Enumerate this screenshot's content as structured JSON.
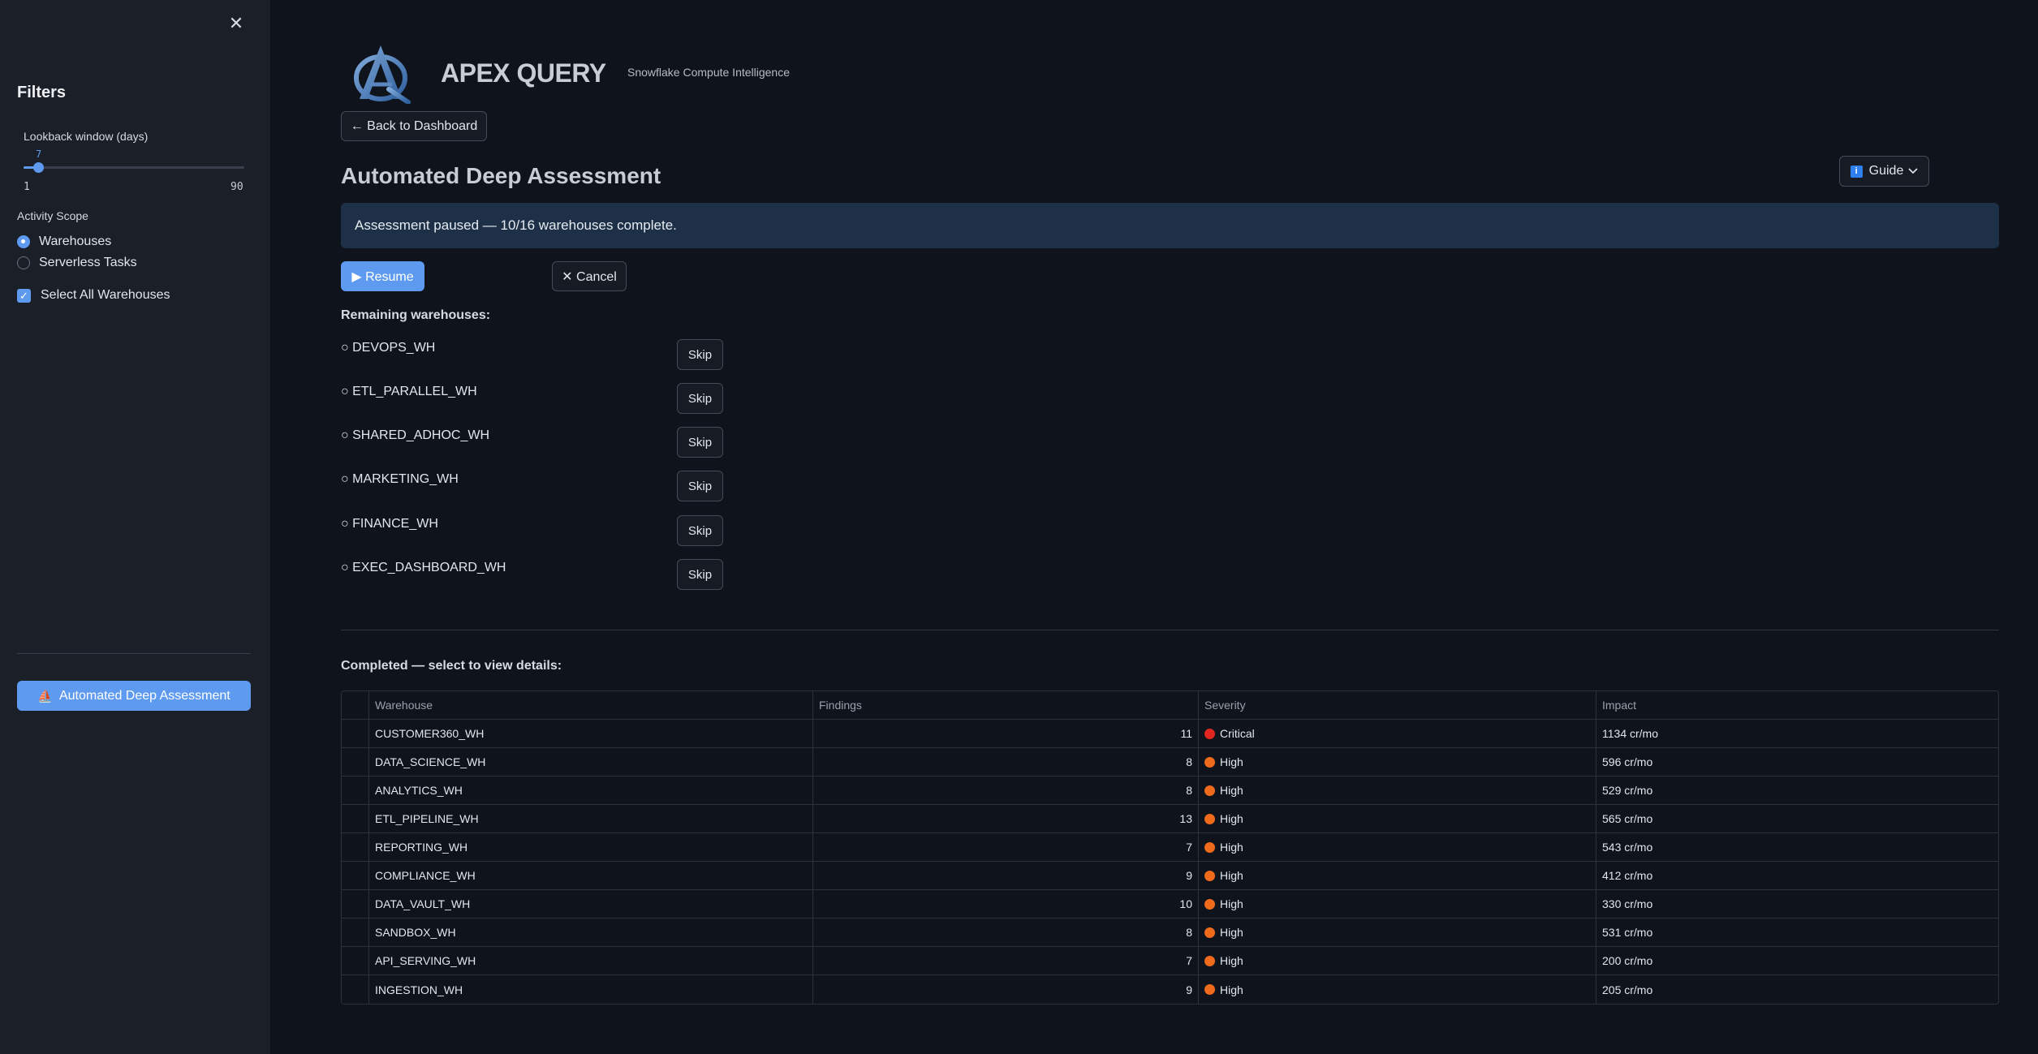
{
  "sidebar": {
    "close_glyph": "✕",
    "filters_title": "Filters",
    "lookback": {
      "label": "Lookback window (days)",
      "value": "7",
      "min": "1",
      "max": "90",
      "value_num": 7,
      "min_num": 1,
      "max_num": 90
    },
    "scope_label": "Activity Scope",
    "scope_options": [
      {
        "label": "Warehouses",
        "selected": true
      },
      {
        "label": "Serverless Tasks",
        "selected": false
      }
    ],
    "select_all_label": "Select All Warehouses",
    "select_all_checked": true,
    "cta_label": "Automated Deep Assessment",
    "cta_icon": "⛵"
  },
  "header": {
    "app_title": "APEX QUERY",
    "app_subtitle": "Snowflake Compute Intelligence",
    "back_label": "← Back to Dashboard"
  },
  "page": {
    "title": "Automated Deep Assessment",
    "guide_label": "Guide",
    "guide_icon": "i",
    "banner_text": "Assessment paused — 10/16 warehouses complete.",
    "resume_label": "▶ Resume",
    "cancel_label": "✕ Cancel",
    "remaining_label": "Remaining warehouses:",
    "remaining": [
      "○ DEVOPS_WH",
      "○ ETL_PARALLEL_WH",
      "○ SHARED_ADHOC_WH",
      "○ MARKETING_WH",
      "○ FINANCE_WH",
      "○ EXEC_DASHBOARD_WH"
    ],
    "skip_label": "Skip",
    "completed_label": "Completed — select to view details:"
  },
  "table": {
    "headers": [
      "Warehouse",
      "Findings",
      "Severity",
      "Impact"
    ],
    "rows": [
      {
        "warehouse": "CUSTOMER360_WH",
        "findings": "11",
        "severity": "Critical",
        "impact": "1134 cr/mo"
      },
      {
        "warehouse": "DATA_SCIENCE_WH",
        "findings": "8",
        "severity": "High",
        "impact": "596 cr/mo"
      },
      {
        "warehouse": "ANALYTICS_WH",
        "findings": "8",
        "severity": "High",
        "impact": "529 cr/mo"
      },
      {
        "warehouse": "ETL_PIPELINE_WH",
        "findings": "13",
        "severity": "High",
        "impact": "565 cr/mo"
      },
      {
        "warehouse": "REPORTING_WH",
        "findings": "7",
        "severity": "High",
        "impact": "543 cr/mo"
      },
      {
        "warehouse": "COMPLIANCE_WH",
        "findings": "9",
        "severity": "High",
        "impact": "412 cr/mo"
      },
      {
        "warehouse": "DATA_VAULT_WH",
        "findings": "10",
        "severity": "High",
        "impact": "330 cr/mo"
      },
      {
        "warehouse": "SANDBOX_WH",
        "findings": "8",
        "severity": "High",
        "impact": "531 cr/mo"
      },
      {
        "warehouse": "API_SERVING_WH",
        "findings": "7",
        "severity": "High",
        "impact": "200 cr/mo"
      },
      {
        "warehouse": "INGESTION_WH",
        "findings": "9",
        "severity": "High",
        "impact": "205 cr/mo"
      }
    ]
  },
  "colors": {
    "accent": "#5e9bf0",
    "critical": "#e0261f",
    "high": "#f06a1c",
    "banner": "#1d3047"
  }
}
